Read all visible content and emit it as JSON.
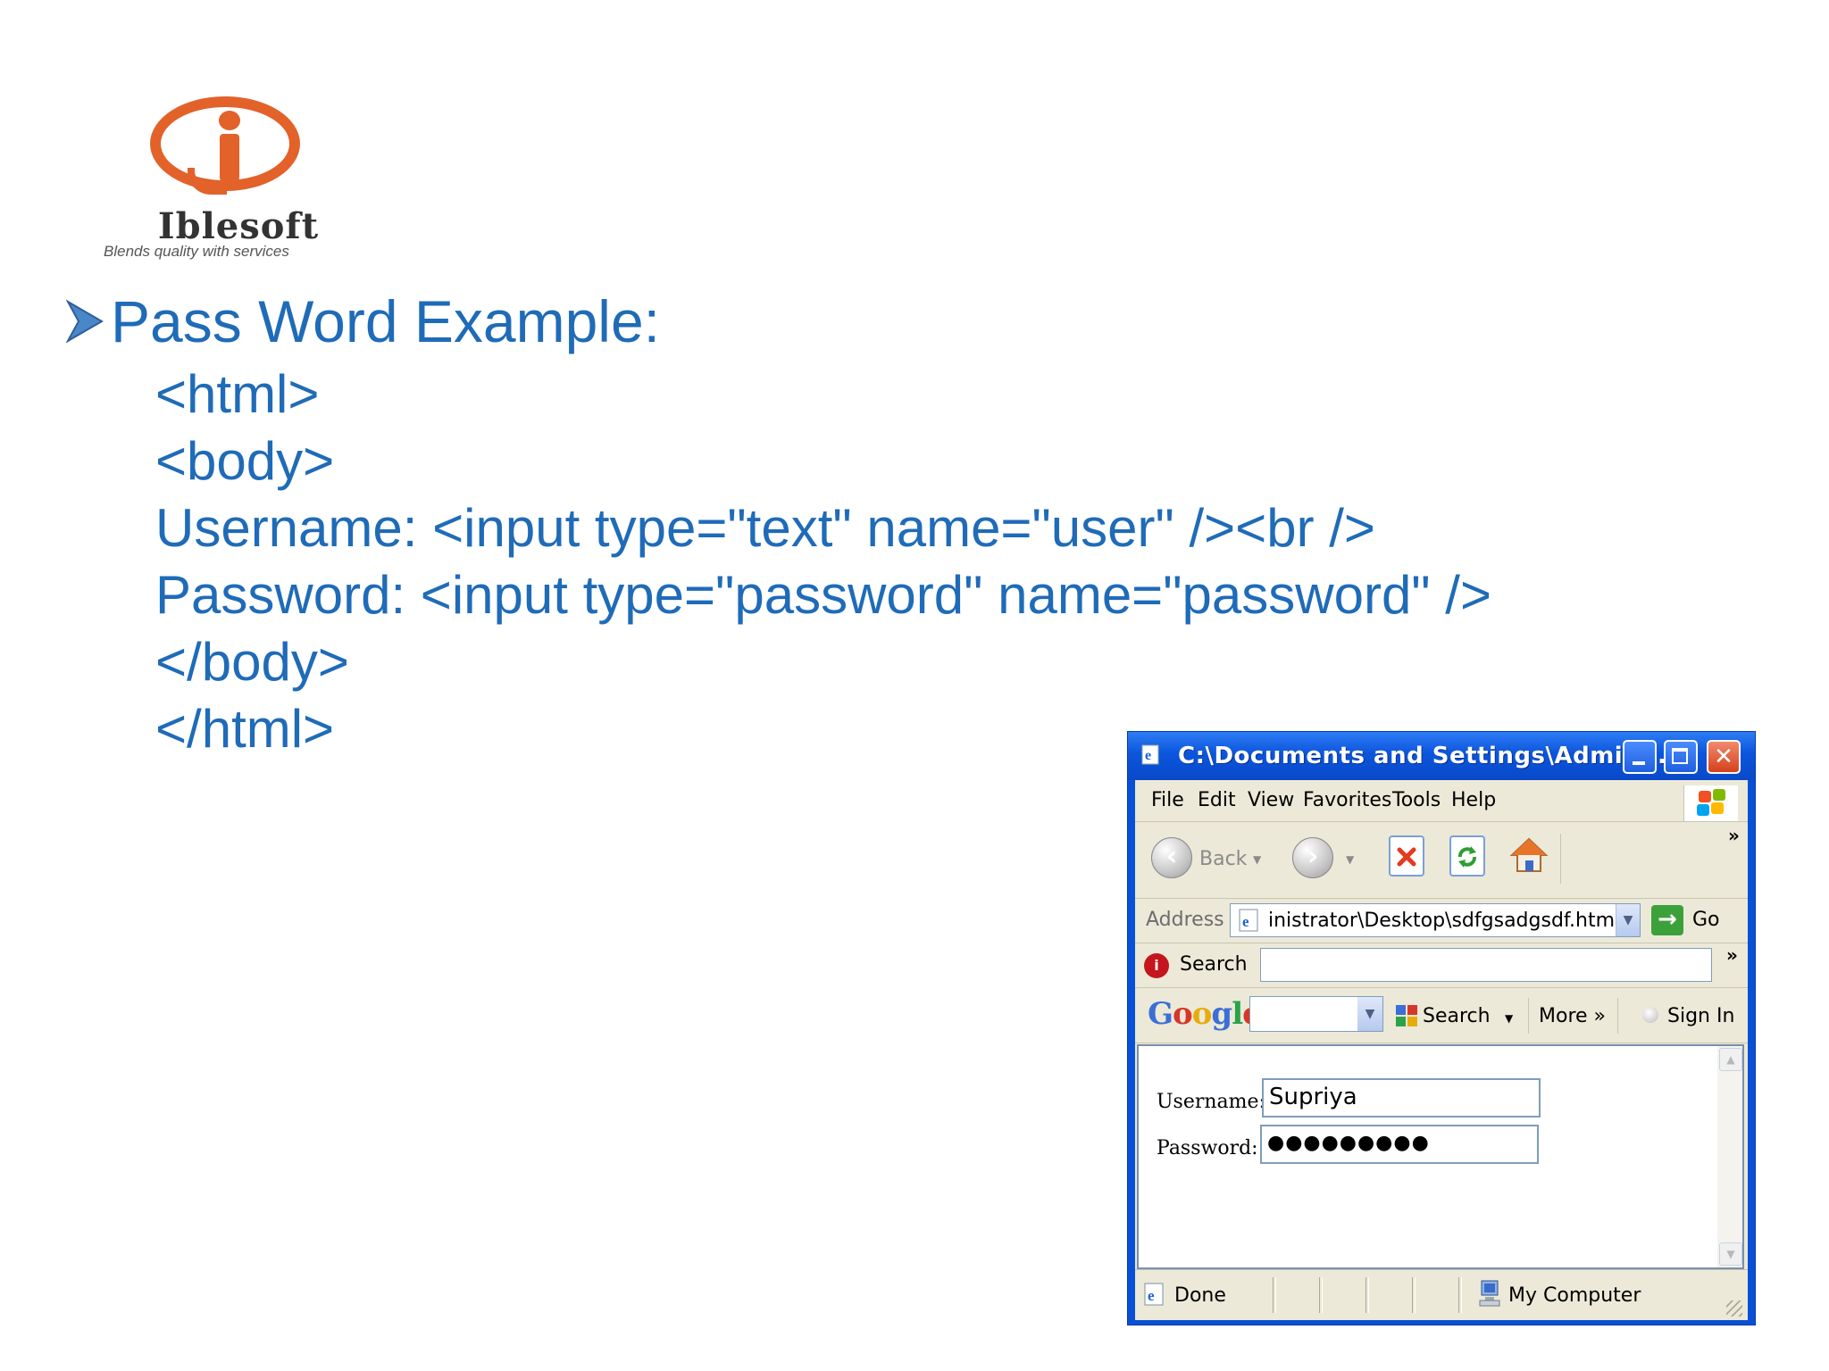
{
  "logo": {
    "name": "Iblesoft",
    "tagline": "Blends quality with services"
  },
  "slide": {
    "heading": "Pass  Word Example:",
    "code_lines": [
      "<html>",
      "<body>",
      "Username: <input type=\"text\" name=\"user\" /><br />",
      "Password: <input type=\"password\" name=\"password\" />",
      "</body>",
      "</html>"
    ]
  },
  "browser": {
    "title": "C:\\Documents and Settings\\Admini...",
    "menu": [
      "File",
      "Edit",
      "View",
      "Favorites",
      "Tools",
      "Help"
    ],
    "toolbar": {
      "back_label": "Back",
      "more_chevron": "»"
    },
    "address": {
      "label": "Address",
      "value": "inistrator\\Desktop\\sdfgsadgsdf.html",
      "go_label": "Go"
    },
    "searchbar": {
      "label": "Search",
      "value": "",
      "more_chevron": "»"
    },
    "google": {
      "logo": "Google",
      "search_label": "Search",
      "more_label": "More »",
      "signin_label": "Sign In"
    },
    "page": {
      "username_label": "Username:",
      "username_value": "Supriya",
      "password_label": "Password:",
      "password_value": "●●●●●●●●●"
    },
    "status": {
      "left": "Done",
      "zone": "My Computer"
    }
  },
  "colors": {
    "accent_text": "#1f6bb8",
    "logo_orange": "#e2622a",
    "xp_titlebar": "#0b55dc"
  }
}
